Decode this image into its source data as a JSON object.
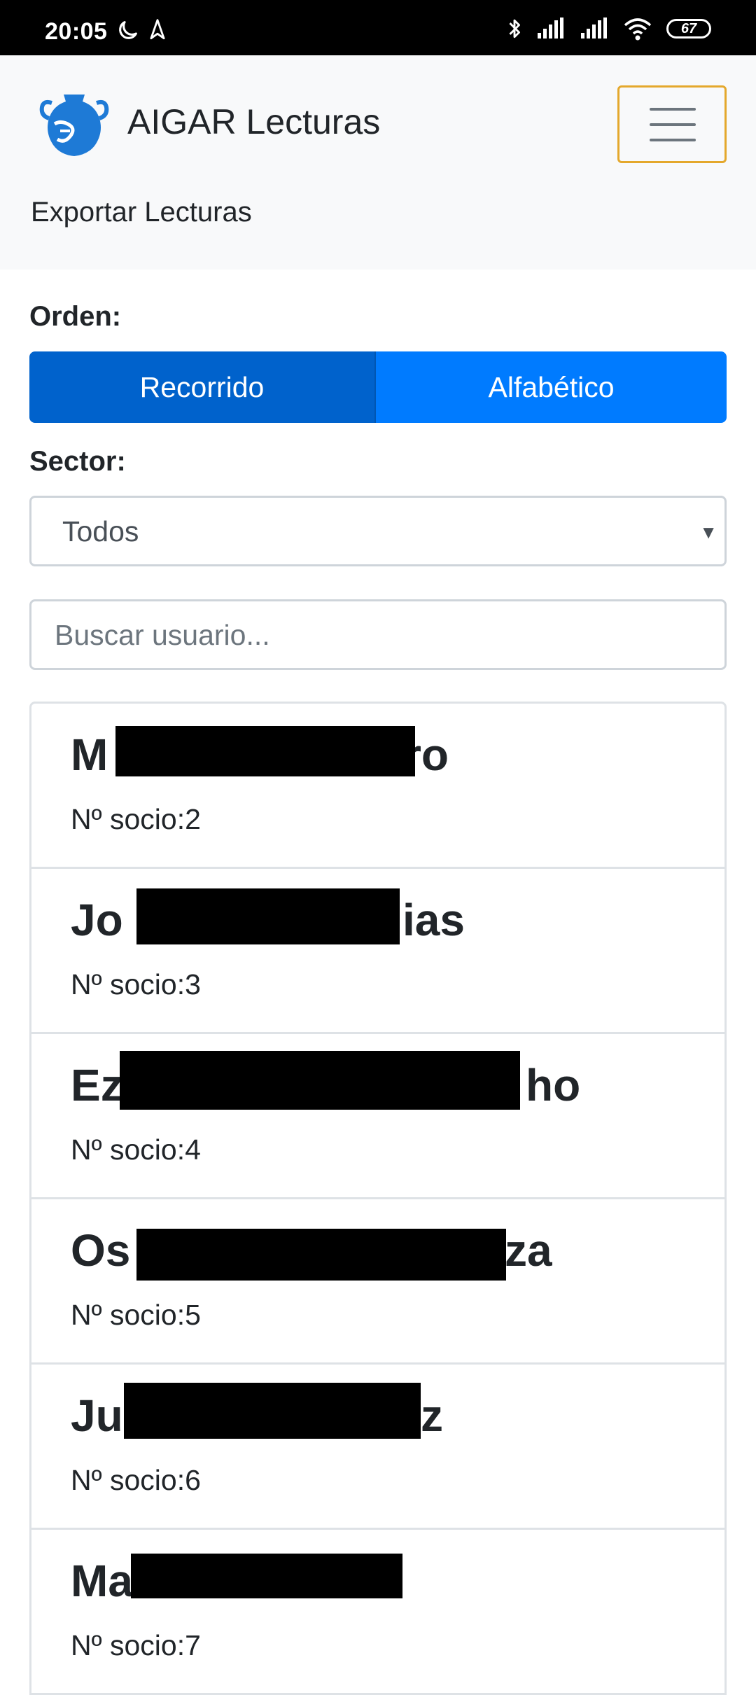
{
  "status_bar": {
    "time": "20:05",
    "battery": "67"
  },
  "navbar": {
    "brand": "AIGAR Lecturas",
    "link": "Exportar Lecturas",
    "brand_color": "#1e7ad6",
    "toggler_border_color": "#e4a82c"
  },
  "filters": {
    "orden_label": "Orden:",
    "orden_options": [
      "Recorrido",
      "Alfabético"
    ],
    "orden_selected": "Recorrido",
    "sector_label": "Sector:",
    "sector_value": "Todos",
    "search_placeholder": "Buscar usuario..."
  },
  "users": [
    {
      "name_start": "M",
      "name_end": "ro",
      "socio": "Nº socio:2"
    },
    {
      "name_start": "Jo",
      "name_end": "ias",
      "socio": "Nº socio:3"
    },
    {
      "name_start": "Ez",
      "name_end": "ho",
      "socio": "Nº socio:4"
    },
    {
      "name_start": "Os",
      "name_end": "za",
      "socio": "Nº socio:5"
    },
    {
      "name_start": "Ju",
      "name_end": "z",
      "socio": "Nº socio:6"
    },
    {
      "name_start": "Ma",
      "name_end": "",
      "socio": "Nº socio:7"
    }
  ],
  "colors": {
    "primary": "#007bff",
    "primary_active": "#0062cc",
    "redaction": "#000000"
  }
}
